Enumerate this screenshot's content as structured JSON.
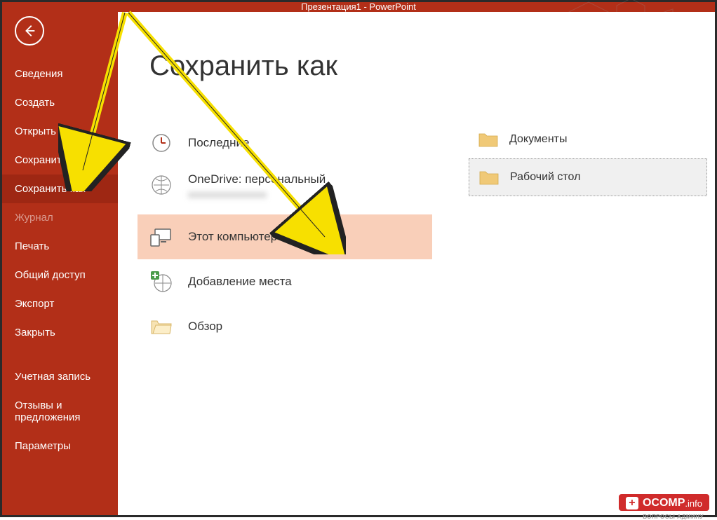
{
  "titlebar": "Презентация1 - PowerPoint",
  "sidebar": {
    "items": [
      {
        "label": "Сведения",
        "active": false
      },
      {
        "label": "Создать",
        "active": false
      },
      {
        "label": "Открыть",
        "active": false
      },
      {
        "label": "Сохранить",
        "active": false
      },
      {
        "label": "Сохранить как",
        "active": true
      },
      {
        "label": "Журнал",
        "active": false,
        "disabled": true
      },
      {
        "label": "Печать",
        "active": false
      },
      {
        "label": "Общий доступ",
        "active": false
      },
      {
        "label": "Экспорт",
        "active": false
      },
      {
        "label": "Закрыть",
        "active": false
      }
    ],
    "footer": [
      {
        "label": "Учетная запись"
      },
      {
        "label": "Отзывы и предложения"
      },
      {
        "label": "Параметры"
      }
    ]
  },
  "page": {
    "title": "Сохранить как"
  },
  "locations": [
    {
      "key": "recent",
      "label": "Последние",
      "icon": "clock"
    },
    {
      "key": "onedrive",
      "label": "OneDrive: персональный",
      "sub": "xxxxxxxxxxxxxxxx",
      "icon": "cloud"
    },
    {
      "key": "thispc",
      "label": "Этот компьютер",
      "icon": "pc",
      "selected": true
    },
    {
      "key": "addplace",
      "label": "Добавление места",
      "icon": "add-globe"
    },
    {
      "key": "browse",
      "label": "Обзор",
      "icon": "folder"
    }
  ],
  "folders": [
    {
      "label": "Документы",
      "selected": false
    },
    {
      "label": "Рабочий стол",
      "selected": true
    }
  ],
  "watermark": {
    "brand": "OCOMP",
    "tld": ".info",
    "sub": "ВОПРОСЫ АДМИНУ"
  }
}
